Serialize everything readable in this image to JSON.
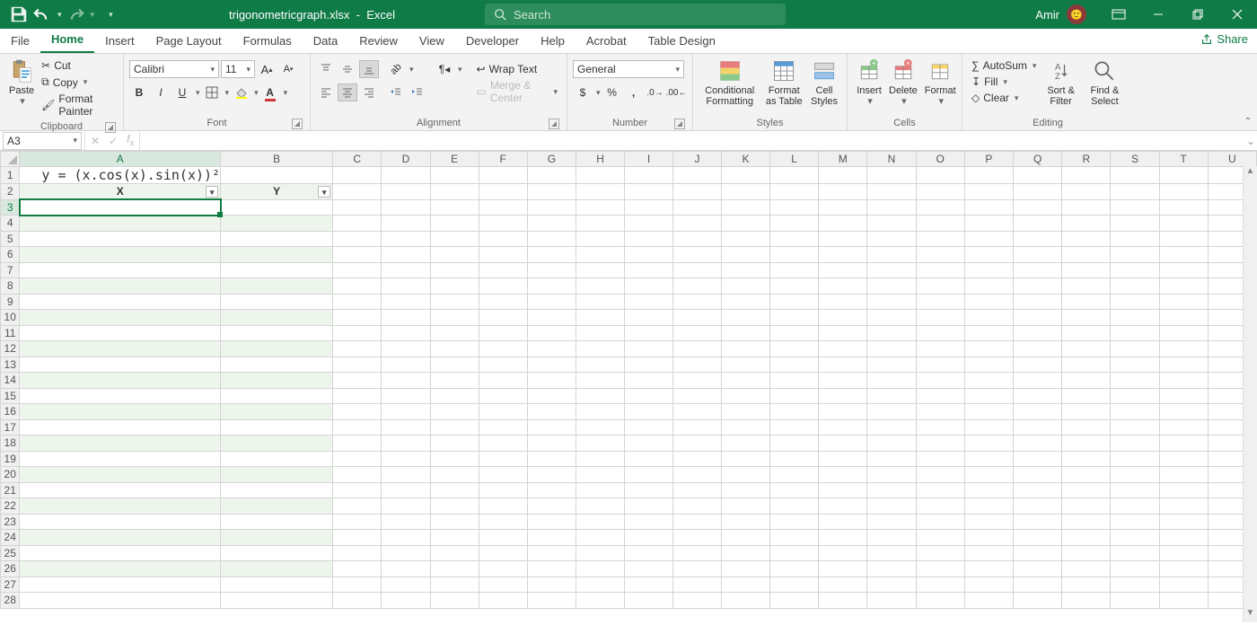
{
  "title": {
    "filename": "trigonometricgraph.xlsx",
    "sep": "-",
    "app": "Excel"
  },
  "search": {
    "placeholder": "Search"
  },
  "user": {
    "name": "Amir"
  },
  "tabs": {
    "file": "File",
    "home": "Home",
    "insert": "Insert",
    "page_layout": "Page Layout",
    "formulas": "Formulas",
    "data": "Data",
    "review": "Review",
    "view": "View",
    "developer": "Developer",
    "help": "Help",
    "acrobat": "Acrobat",
    "table_design": "Table Design",
    "share": "Share"
  },
  "ribbon": {
    "clipboard": {
      "paste": "Paste",
      "cut": "Cut",
      "copy": "Copy",
      "format_painter": "Format Painter",
      "label": "Clipboard"
    },
    "font": {
      "name": "Calibri",
      "size": "11",
      "label": "Font"
    },
    "alignment": {
      "wrap": "Wrap Text",
      "merge": "Merge & Center",
      "label": "Alignment"
    },
    "number": {
      "format": "General",
      "label": "Number"
    },
    "styles": {
      "cond": "Conditional Formatting",
      "table": "Format as Table",
      "cell": "Cell Styles",
      "label": "Styles"
    },
    "cells": {
      "insert": "Insert",
      "delete": "Delete",
      "format": "Format",
      "label": "Cells"
    },
    "editing": {
      "autosum": "AutoSum",
      "fill": "Fill",
      "clear": "Clear",
      "sort": "Sort & Filter",
      "find": "Find & Select",
      "label": "Editing"
    }
  },
  "namebox": "A3",
  "formula": "",
  "columns": [
    "A",
    "B",
    "C",
    "D",
    "E",
    "F",
    "G",
    "H",
    "I",
    "J",
    "K",
    "L",
    "M",
    "N",
    "O",
    "P",
    "Q",
    "R",
    "S",
    "T",
    "U"
  ],
  "rows": 28,
  "cells": {
    "A1": "y = (x.cos(x).sin(x))²",
    "A2": "X",
    "B2": "Y"
  },
  "table_range": {
    "cols": [
      "A",
      "B"
    ],
    "first_row": 2,
    "last_row": 27
  },
  "selected": "A3"
}
